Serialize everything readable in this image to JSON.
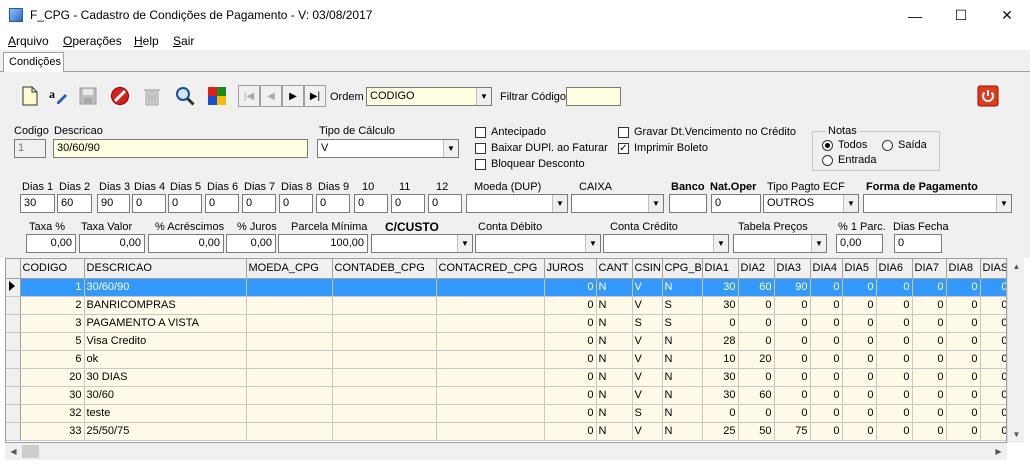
{
  "window": {
    "title": "F_CPG - Cadastro de Condições de Pagamento - V: 03/08/2017",
    "minimize": "—",
    "maximize": "☐",
    "close": "✕"
  },
  "menu": [
    {
      "label": "Arquivo",
      "accel": "A"
    },
    {
      "label": "Operações",
      "accel": "O"
    },
    {
      "label": "Help",
      "accel": "H"
    },
    {
      "label": "Sair",
      "accel": "S"
    }
  ],
  "tab": "Condições",
  "toolbar": {
    "ordem_label": "Ordem",
    "ordem_value": "CODIGO",
    "filtrar_label": "Filtrar Código",
    "filtrar_value": "",
    "nav_first": "|◀",
    "nav_prev": "◀",
    "nav_next": "▶",
    "nav_last": "▶|"
  },
  "form": {
    "codigo_label": "Codigo",
    "codigo_value": "1",
    "descricao_label": "Descricao",
    "descricao_value": "30/60/90",
    "tipo_calculo_label": "Tipo de Cálculo",
    "tipo_calculo_value": "V",
    "antecipado": "Antecipado",
    "baixar_dupl": "Baixar DUPl. ao Faturar",
    "bloquear_desconto": "Bloquear Desconto",
    "gravar_dt": "Gravar Dt.Vencimento no Crédito",
    "imprimir_boleto": "Imprimir Boleto",
    "notas_label": "Notas",
    "notas_todos": "Todos",
    "notas_saida": "Saída",
    "notas_entrada": "Entrada",
    "dias": [
      {
        "label": "Dias 1",
        "value": "30"
      },
      {
        "label": "Dias 2",
        "value": "60"
      },
      {
        "label": "Dias 3",
        "value": "90"
      },
      {
        "label": "Dias 4",
        "value": "0"
      },
      {
        "label": "Dias 5",
        "value": "0"
      },
      {
        "label": "Dias 6",
        "value": "0"
      },
      {
        "label": "Dias 7",
        "value": "0"
      },
      {
        "label": "Dias 8",
        "value": "0"
      },
      {
        "label": "Dias 9",
        "value": "0"
      },
      {
        "label": "10",
        "value": "0"
      },
      {
        "label": "11",
        "value": "0"
      },
      {
        "label": "12",
        "value": "0"
      }
    ],
    "moeda_label": "Moeda (DUP)",
    "caixa_label": "CAIXA",
    "banco_label": "Banco",
    "natoper_label": "Nat.Oper",
    "natoper_value": "0",
    "tipo_pagto_label": "Tipo Pagto ECF",
    "tipo_pagto_value": "OUTROS",
    "forma_pagamento_label": "Forma de Pagamento",
    "taxa_label": "Taxa %",
    "taxa_value": "0,00",
    "taxa_valor_label": "Taxa Valor",
    "taxa_valor_value": "0,00",
    "acrescimos_label": "% Acréscimos",
    "acrescimos_value": "0,00",
    "juros_label": "% Juros",
    "juros_value": "0,00",
    "parcela_label": "Parcela Mínima",
    "parcela_value": "100,00",
    "ccusto_label": "C/CUSTO",
    "conta_debito_label": "Conta Débito",
    "conta_credito_label": "Conta Crédito",
    "tabela_precos_label": "Tabela Preços",
    "um_parc_label": "% 1 Parc.",
    "um_parc_value": "0,00",
    "dias_fecha_label": "Dias Fecha",
    "dias_fecha_value": "0"
  },
  "grid": {
    "columns": [
      "CODIGO",
      "DESCRICAO",
      "MOEDA_CPG",
      "CONTADEB_CPG",
      "CONTACRED_CPG",
      "JUROS",
      "CANT",
      "CSIN",
      "CPG_BAI",
      "DIA1",
      "DIA2",
      "DIA3",
      "DIA4",
      "DIA5",
      "DIA6",
      "DIA7",
      "DIA8",
      "DIAS"
    ],
    "rows": [
      [
        "1",
        "30/60/90",
        "",
        "",
        "",
        "0",
        "N",
        "V",
        "N",
        "30",
        "60",
        "90",
        "0",
        "0",
        "0",
        "0",
        "0",
        "0"
      ],
      [
        "2",
        "BANRICOMPRAS",
        "",
        "",
        "",
        "0",
        "N",
        "V",
        "S",
        "30",
        "0",
        "0",
        "0",
        "0",
        "0",
        "0",
        "0",
        "0"
      ],
      [
        "3",
        "PAGAMENTO A VISTA",
        "",
        "",
        "",
        "0",
        "N",
        "S",
        "S",
        "0",
        "0",
        "0",
        "0",
        "0",
        "0",
        "0",
        "0",
        "0"
      ],
      [
        "5",
        "Visa Credito",
        "",
        "",
        "",
        "0",
        "N",
        "V",
        "N",
        "28",
        "0",
        "0",
        "0",
        "0",
        "0",
        "0",
        "0",
        "0"
      ],
      [
        "6",
        "ok",
        "",
        "",
        "",
        "0",
        "N",
        "V",
        "N",
        "10",
        "20",
        "0",
        "0",
        "0",
        "0",
        "0",
        "0",
        "0"
      ],
      [
        "20",
        "30 DIAS",
        "",
        "",
        "",
        "0",
        "N",
        "V",
        "N",
        "30",
        "0",
        "0",
        "0",
        "0",
        "0",
        "0",
        "0",
        "0"
      ],
      [
        "30",
        "30/60",
        "",
        "",
        "",
        "0",
        "N",
        "V",
        "N",
        "30",
        "60",
        "0",
        "0",
        "0",
        "0",
        "0",
        "0",
        "0"
      ],
      [
        "32",
        "teste",
        "",
        "",
        "",
        "0",
        "N",
        "S",
        "N",
        "0",
        "0",
        "0",
        "0",
        "0",
        "0",
        "0",
        "0",
        "0"
      ],
      [
        "33",
        "25/50/75",
        "",
        "",
        "",
        "0",
        "N",
        "V",
        "N",
        "25",
        "50",
        "75",
        "0",
        "0",
        "0",
        "0",
        "0",
        "0"
      ]
    ]
  }
}
